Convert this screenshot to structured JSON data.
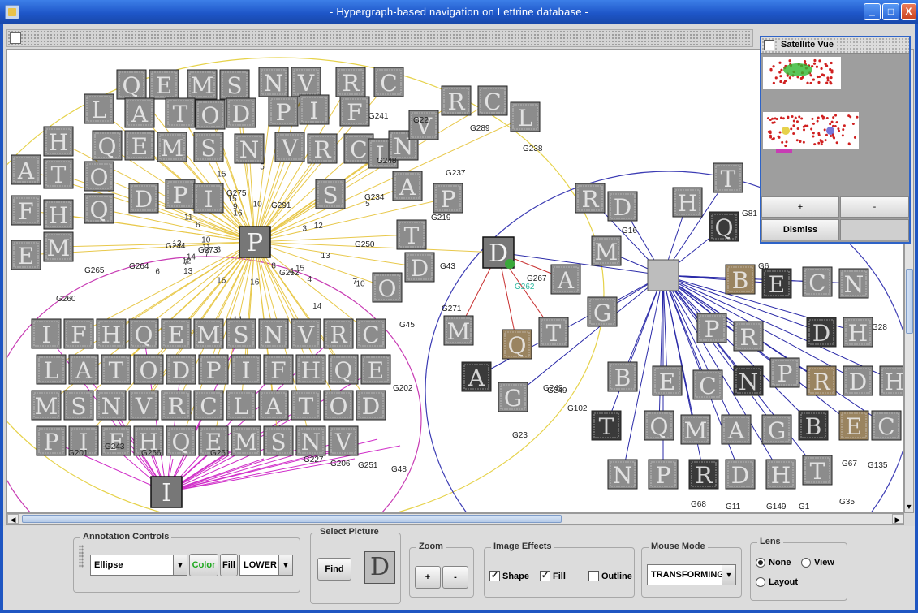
{
  "window": {
    "title": "- Hypergraph-based navigation on Lettrine database -",
    "minimize_glyph": "_",
    "maximize_glyph": "□",
    "close_glyph": "X"
  },
  "graph": {
    "node_labels": [
      "G241",
      "G22",
      "G289",
      "G238",
      "G237",
      "G248",
      "G267",
      "G275",
      "G291",
      "G234",
      "G244",
      "G273",
      "G264",
      "G265",
      "G250",
      "G252",
      "G219",
      "G260",
      "G271",
      "G43",
      "G45",
      "G23",
      "G249",
      "G102",
      "G16",
      "G81",
      "G6",
      "G28",
      "G67",
      "G135",
      "G201",
      "G243",
      "G256",
      "G261",
      "G227",
      "G206",
      "G251",
      "G48",
      "G202",
      "G68",
      "G11",
      "G149",
      "G1",
      "G35",
      "G262",
      "G249"
    ],
    "edge_weights": [
      "13",
      "15",
      "12",
      "7",
      "6",
      "14",
      "16",
      "10",
      "9",
      "11",
      "8",
      "5",
      "4",
      "3"
    ],
    "letters_left": [
      "Q",
      "E",
      "M",
      "S",
      "N",
      "V",
      "R",
      "C",
      "L",
      "A",
      "T",
      "O",
      "D",
      "P",
      "I",
      "F",
      "H"
    ],
    "letters_right": [
      "R",
      "D",
      "H",
      "T",
      "Q",
      "M",
      "A",
      "G",
      "B",
      "E",
      "C",
      "N",
      "P"
    ],
    "hub_left_letter": "P",
    "hub_center_letter": "D",
    "hub_bottom_letter": "I",
    "colors": {
      "yellow_edges": "#e8c84a",
      "red_edges": "#c83030",
      "blue_edges": "#2a2aa8",
      "magenta_edges": "#d02cc8",
      "yellow_ellipse": "#e6d24a",
      "magenta_ellipse": "#c83cb4",
      "blue_ellipse": "#3c3cb4",
      "sepia_tile": "#9a8460",
      "grey_tile": "#8c8c8c"
    }
  },
  "satellite": {
    "title": "Satellite Vue",
    "plus_label": "+",
    "minus_label": "-",
    "dismiss_label": "Dismiss"
  },
  "controls": {
    "annotation": {
      "title": "Annotation Controls",
      "shape_value": "Ellipse",
      "color_label": "Color",
      "fill_label": "Fill",
      "layer_value": "LOWER"
    },
    "select_picture": {
      "title": "Select Picture",
      "find_label": "Find",
      "preview_letter": "D"
    },
    "zoom": {
      "title": "Zoom",
      "plus_label": "+",
      "minus_label": "-"
    },
    "image_effects": {
      "title": "Image Effects",
      "shape_label": "Shape",
      "shape_checked": true,
      "fill_label": "Fill",
      "fill_checked": true,
      "outline_label": "Outline",
      "outline_checked": false
    },
    "mouse_mode": {
      "title": "Mouse Mode",
      "value": "TRANSFORMING"
    },
    "lens": {
      "title": "Lens",
      "none_label": "None",
      "view_label": "View",
      "layout_label": "Layout",
      "selected": "None"
    }
  },
  "icons": {
    "combo_arrow": "▼",
    "check": "✓",
    "scroll_left": "◀",
    "scroll_right": "▶",
    "scroll_down": "▼"
  }
}
